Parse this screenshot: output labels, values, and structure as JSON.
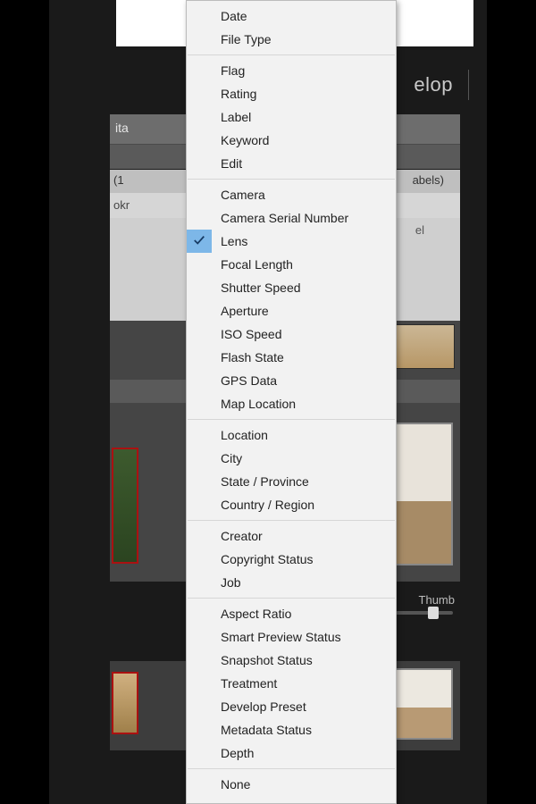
{
  "header": {
    "tab_visible": "elop"
  },
  "toolbar1": {
    "frag": "ita"
  },
  "filterbar": {
    "left_frag": "(1",
    "right_frag": "abels)"
  },
  "subbar": {
    "left_frag": "okr"
  },
  "panel": {
    "right_frag": "el"
  },
  "thumblabel": {
    "text": "Thumb"
  },
  "menu": {
    "groups": [
      {
        "items": [
          {
            "label": "Date",
            "checked": false
          },
          {
            "label": "File Type",
            "checked": false
          }
        ]
      },
      {
        "items": [
          {
            "label": "Flag",
            "checked": false
          },
          {
            "label": "Rating",
            "checked": false
          },
          {
            "label": "Label",
            "checked": false
          },
          {
            "label": "Keyword",
            "checked": false
          },
          {
            "label": "Edit",
            "checked": false
          }
        ]
      },
      {
        "items": [
          {
            "label": "Camera",
            "checked": false
          },
          {
            "label": "Camera Serial Number",
            "checked": false
          },
          {
            "label": "Lens",
            "checked": true
          },
          {
            "label": "Focal Length",
            "checked": false
          },
          {
            "label": "Shutter Speed",
            "checked": false
          },
          {
            "label": "Aperture",
            "checked": false
          },
          {
            "label": "ISO Speed",
            "checked": false
          },
          {
            "label": "Flash State",
            "checked": false
          },
          {
            "label": "GPS Data",
            "checked": false
          },
          {
            "label": "Map Location",
            "checked": false
          }
        ]
      },
      {
        "items": [
          {
            "label": "Location",
            "checked": false
          },
          {
            "label": "City",
            "checked": false
          },
          {
            "label": "State / Province",
            "checked": false
          },
          {
            "label": "Country / Region",
            "checked": false
          }
        ]
      },
      {
        "items": [
          {
            "label": "Creator",
            "checked": false
          },
          {
            "label": "Copyright Status",
            "checked": false
          },
          {
            "label": "Job",
            "checked": false
          }
        ]
      },
      {
        "items": [
          {
            "label": "Aspect Ratio",
            "checked": false
          },
          {
            "label": "Smart Preview Status",
            "checked": false
          },
          {
            "label": "Snapshot Status",
            "checked": false
          },
          {
            "label": "Treatment",
            "checked": false
          },
          {
            "label": "Develop Preset",
            "checked": false
          },
          {
            "label": "Metadata Status",
            "checked": false
          },
          {
            "label": "Depth",
            "checked": false
          }
        ]
      },
      {
        "items": [
          {
            "label": "None",
            "checked": false
          }
        ]
      }
    ]
  }
}
